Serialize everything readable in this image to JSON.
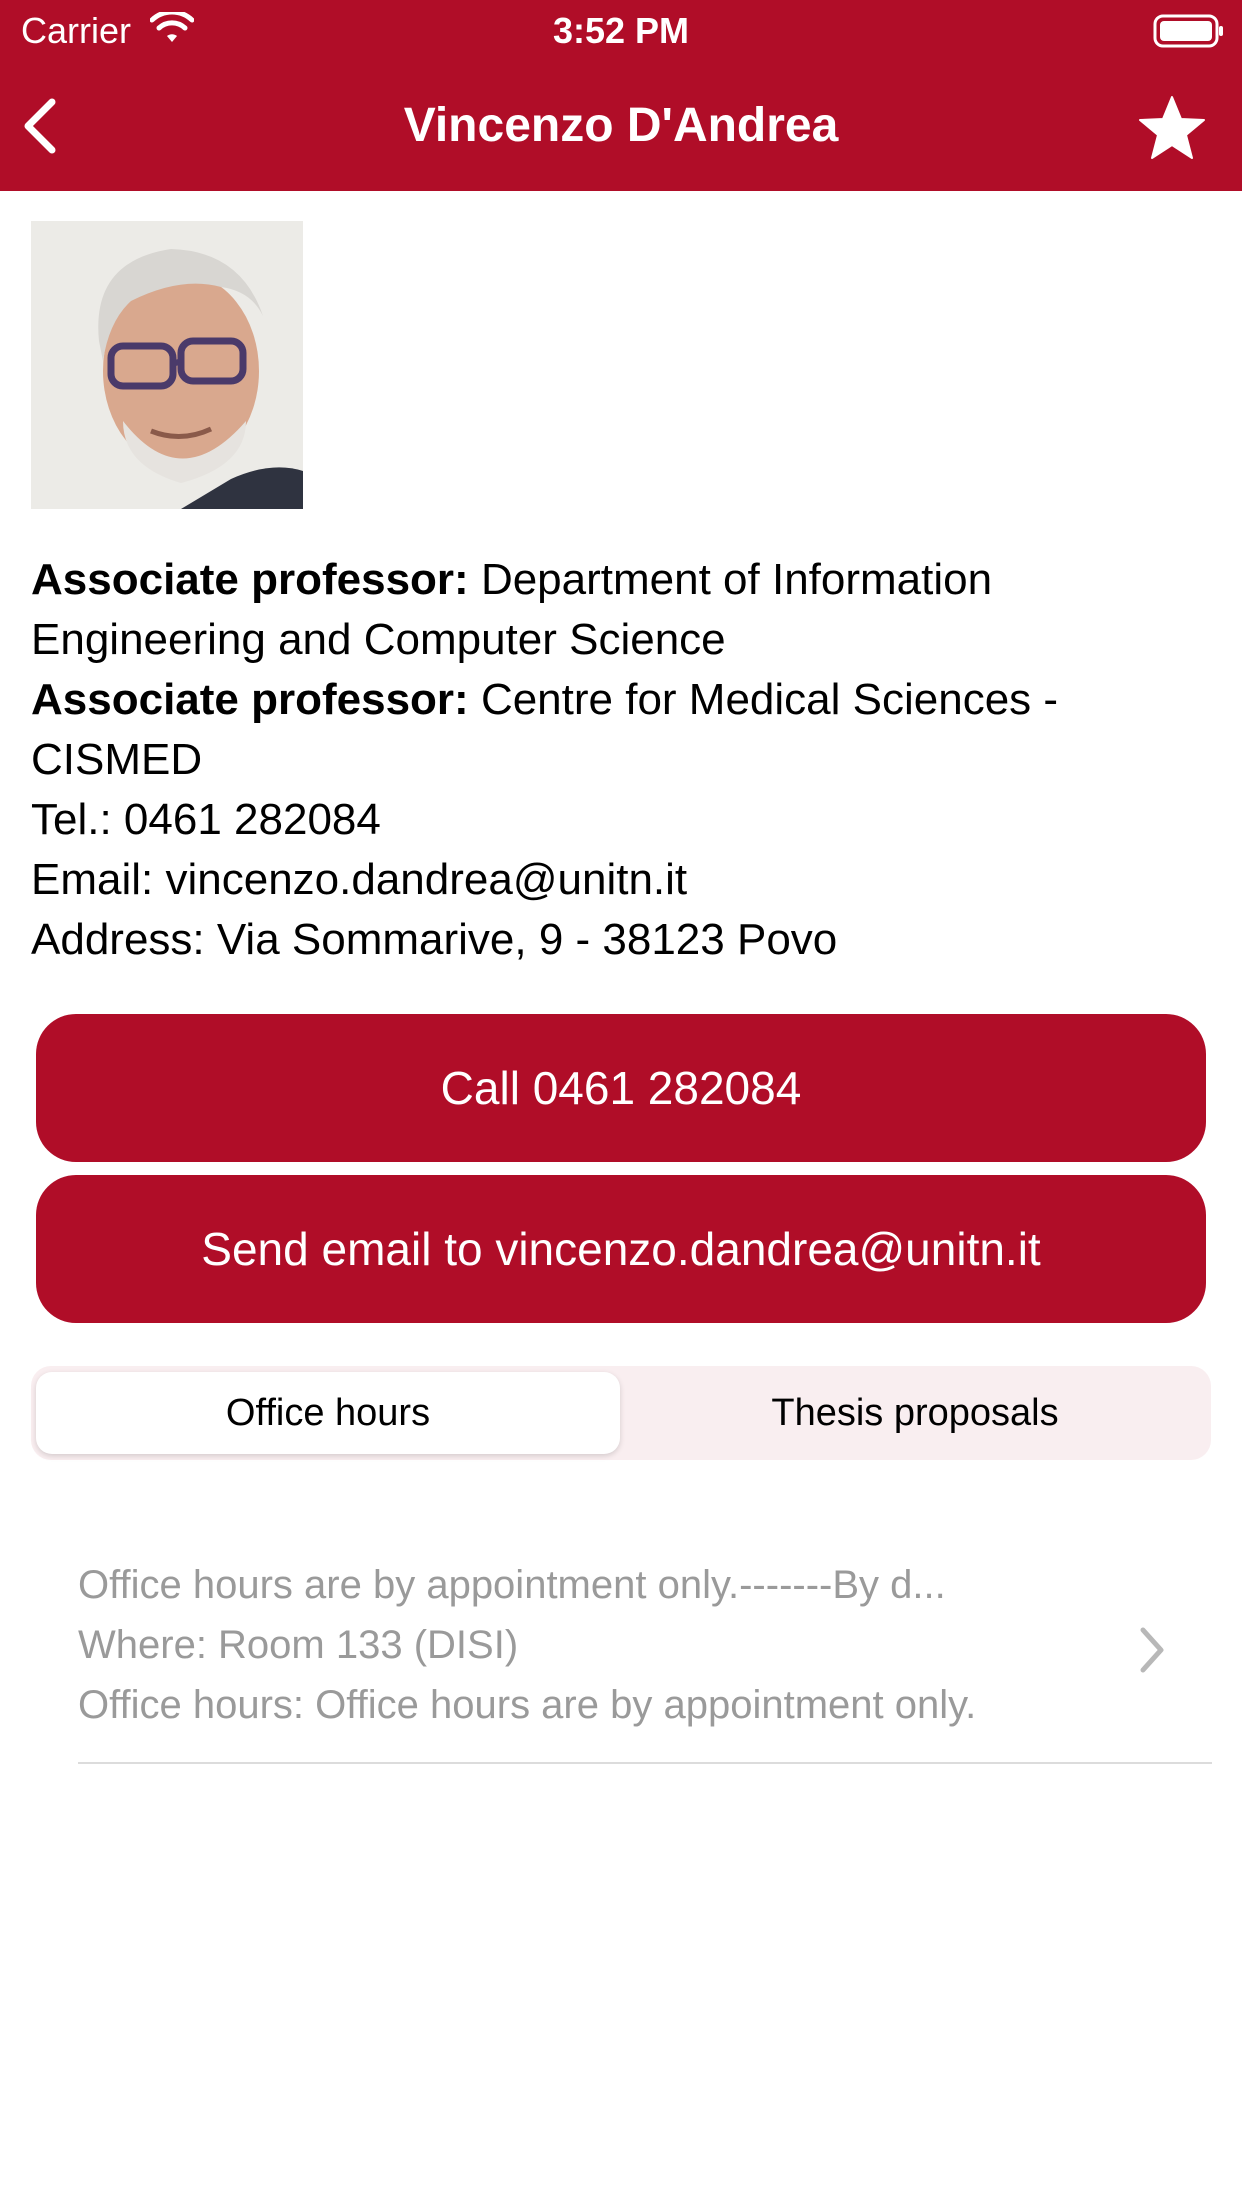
{
  "status_bar": {
    "carrier": "Carrier",
    "time": "3:52 PM",
    "icons": [
      "wifi-icon",
      "battery-icon"
    ]
  },
  "nav": {
    "title": "Vincenzo D'Andrea",
    "back_icon": "chevron-left-icon",
    "favorite_icon": "star-icon"
  },
  "profile": {
    "roles": [
      {
        "label": "Associate professor:",
        "value": "Department of Information Engineering and Computer Science"
      },
      {
        "label": "Associate professor:",
        "value": "Centre for Medical Sciences - CISMED"
      }
    ],
    "tel": "Tel.: 0461 282084",
    "email": "Email: vincenzo.dandrea@unitn.it",
    "address": "Address: Via Sommarive, 9 - 38123 Povo"
  },
  "actions": {
    "call_label": "Call 0461 282084",
    "email_label": "Send email to vincenzo.dandrea@unitn.it"
  },
  "tabs": {
    "office_hours": "Office hours",
    "thesis_proposals": "Thesis proposals",
    "selected": "Office hours"
  },
  "office_hours_entry": {
    "summary": "Office hours are by appointment only.-------By d...",
    "where": "Where: Room 133 (DISI)",
    "hours": "Office hours: Office hours are by appointment only."
  },
  "colors": {
    "brand": "#b00d28",
    "muted_text": "#9a9a9a",
    "segment_bg": "#f9eef0"
  }
}
